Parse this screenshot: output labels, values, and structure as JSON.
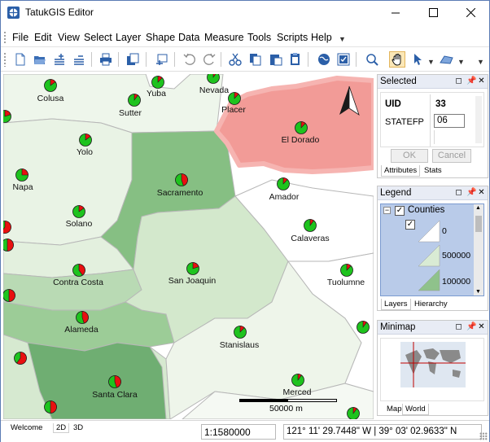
{
  "window": {
    "title": "TatukGIS Editor",
    "app_icon": "tatukgis-app-icon",
    "controls": [
      "minimize-icon",
      "maximize-icon",
      "close-icon"
    ]
  },
  "menu": {
    "items": [
      "File",
      "Edit",
      "View",
      "Select",
      "Layer",
      "Shape",
      "Data",
      "Measure",
      "Tools",
      "Scripts",
      "Help"
    ]
  },
  "toolbar": {
    "buttons": [
      "new-icon",
      "open-icon",
      "add-layer-icon",
      "remove-layer-icon",
      "print-icon",
      "copy-window-icon",
      "export-icon",
      "undo-icon",
      "redo-icon",
      "cut-icon",
      "copy-icon",
      "paste-icon",
      "paste-special-icon",
      "globe-icon",
      "properties-icon",
      "zoom-icon",
      "pan-hand-icon",
      "select-arrow-icon",
      "shape-tool-icon"
    ],
    "active": "pan-hand-icon"
  },
  "map": {
    "counties": [
      "Colusa",
      "Sutter",
      "Yuba",
      "Nevada",
      "Placer",
      "El Dorado",
      "Yolo",
      "Napa",
      "Sacramento",
      "Amador",
      "Solano",
      "Calaveras",
      "Contra Costa",
      "San Joaquin",
      "Tuolumne",
      "Alameda",
      "Stanislaus",
      "Santa Clara",
      "Merced"
    ],
    "selected_county": "El Dorado",
    "scalebar": "50000 m",
    "colors": {
      "selection": "#f29b97",
      "pie_green": "#1ec31e",
      "pie_red": "#e81010",
      "dark_fill": "#6fae72",
      "mid_fill": "#a6d0a2",
      "light_fill": "#d9ebd4"
    }
  },
  "selected_panel": {
    "title": "Selected",
    "field_uid_label": "UID",
    "field_uid_value": "33",
    "field_statefp_label": "STATEFP",
    "field_statefp_value": "06",
    "ok_label": "OK",
    "cancel_label": "Cancel",
    "tabs": [
      "Attributes",
      "Stats"
    ]
  },
  "legend_panel": {
    "title": "Legend",
    "layer_name": "Counties",
    "classes": [
      "0",
      "500000",
      "100000"
    ],
    "tabs": [
      "Layers",
      "Hierarchy"
    ]
  },
  "minimap_panel": {
    "title": "Minimap",
    "tabs": [
      "Map",
      "World"
    ]
  },
  "statusbar": {
    "view_tabs": [
      "Welcome",
      "2D",
      "3D"
    ],
    "scale": "1:1580000",
    "coordinates": "121° 11' 29.7448\" W | 39° 03' 02.9633\" N"
  }
}
